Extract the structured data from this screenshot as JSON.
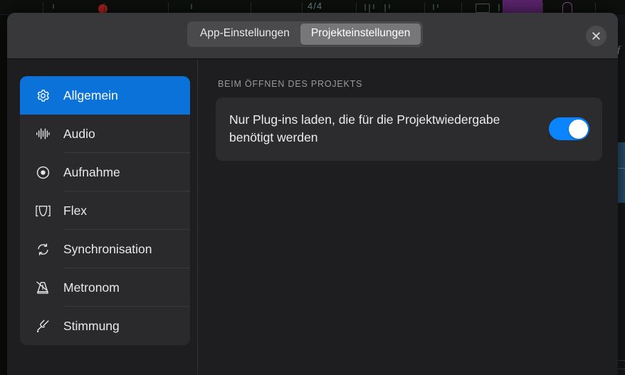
{
  "background": {
    "time_signature": "4/4",
    "app_description": "daw-timeline-behind-modal"
  },
  "modal": {
    "header": {
      "tabs": [
        {
          "label": "App-Einstellungen",
          "active": false,
          "name": "tab-app-settings"
        },
        {
          "label": "Projekteinstellungen",
          "active": true,
          "name": "tab-project-settings"
        }
      ],
      "close_label": "×"
    },
    "sidebar": {
      "items": [
        {
          "label": "Allgemein",
          "icon": "gear-icon",
          "selected": true
        },
        {
          "label": "Audio",
          "icon": "audio-waveform-icon",
          "selected": false
        },
        {
          "label": "Aufnahme",
          "icon": "record-circle-icon",
          "selected": false
        },
        {
          "label": "Flex",
          "icon": "flex-icon",
          "selected": false
        },
        {
          "label": "Synchronisation",
          "icon": "sync-arrows-icon",
          "selected": false
        },
        {
          "label": "Metronom",
          "icon": "metronome-icon",
          "selected": false
        },
        {
          "label": "Stimmung",
          "icon": "tuning-fork-icon",
          "selected": false
        }
      ]
    },
    "content": {
      "section_title": "BEIM ÖFFNEN DES PROJEKTS",
      "settings": [
        {
          "label": "Nur Plug-ins laden, die für die Projektwiedergabe benötigt werden",
          "toggle_on": true
        }
      ]
    }
  },
  "colors": {
    "accent_selected": "#0a72d8",
    "accent_toggle": "#0a84ff",
    "header_bg": "#38383a",
    "modal_bg": "#1e1e20",
    "card_bg": "#2c2c2e",
    "list_bg": "#2a2a2c"
  }
}
